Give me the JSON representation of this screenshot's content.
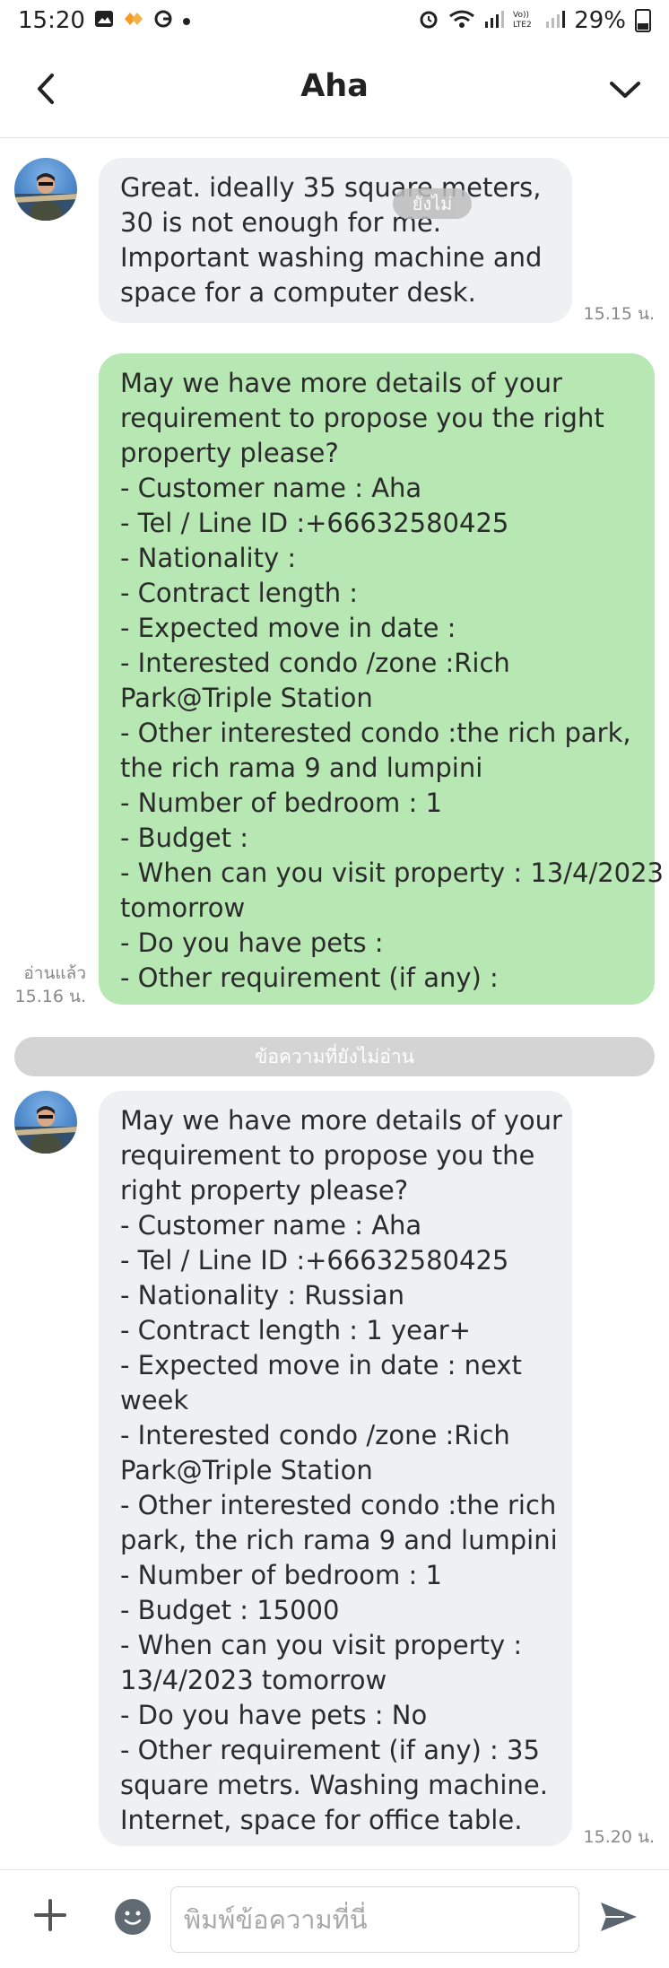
{
  "status_bar": {
    "time": "15:20",
    "left_icons": [
      "image-icon",
      "app-icon",
      "google-icon",
      "dot-icon"
    ],
    "right_icons": [
      "alarm-icon",
      "wifi-icon",
      "signal-icon",
      "volte-icon",
      "signal-icon-2"
    ],
    "battery": "29%"
  },
  "header": {
    "title": "Aha"
  },
  "messages": [
    {
      "direction": "in",
      "lines": [
        "Great.  ideally 35 square meters,",
        "30 is not enough for me.",
        " Important washing machine and",
        "space for a computer desk."
      ],
      "time": "15.15 น.",
      "floating_label": "ยังไม่"
    },
    {
      "direction": "out",
      "lines": [
        "May we have more details of your",
        "requirement to propose you the right",
        "property please?",
        "- Customer name : Aha",
        "- Tel / Line ID :+66632580425",
        "- Nationality :",
        "- Contract length :",
        "- Expected move in date :",
        "- Interested condo /zone :Rich",
        "Park@Triple Station",
        "- Other interested condo :the rich park,",
        "the rich rama 9 and lumpini",
        "- Number of bedroom  : 1",
        "- Budget :",
        "- When can you visit property : 13/4/2023",
        "tomorrow",
        "- Do you have pets :",
        "- Other requirement (if any) :"
      ],
      "read": "อ่านแล้ว",
      "time": "15.16 น."
    },
    {
      "direction": "in",
      "lines": [
        "May we have more details of your",
        "requirement to propose you the",
        "right property please?",
        "- Customer name : Aha",
        "- Tel / Line ID :+66632580425",
        "- Nationality : Russian",
        "- Contract length :  1 year+",
        "- Expected move in date : next",
        "week",
        "- Interested condo /zone :Rich",
        "Park@Triple Station",
        "- Other interested condo :the rich",
        "park, the rich rama 9 and lumpini",
        "- Number of bedroom  : 1",
        "- Budget :  15000",
        "- When can you visit property :",
        "13/4/2023 tomorrow",
        "- Do you have pets : No",
        "- Other requirement (if any) : 35",
        "square  metrs. Washing machine.",
        "Internet, space for office table."
      ],
      "time": "15.20 น."
    }
  ],
  "unread_divider": "ข้อความที่ยังไม่อ่าน",
  "composer": {
    "placeholder": "พิมพ์ข้อความที่นี่"
  },
  "colors": {
    "incoming_bubble": "#eef0f2",
    "outgoing_bubble": "#b7e8b3",
    "divider": "#d4d4d4"
  }
}
